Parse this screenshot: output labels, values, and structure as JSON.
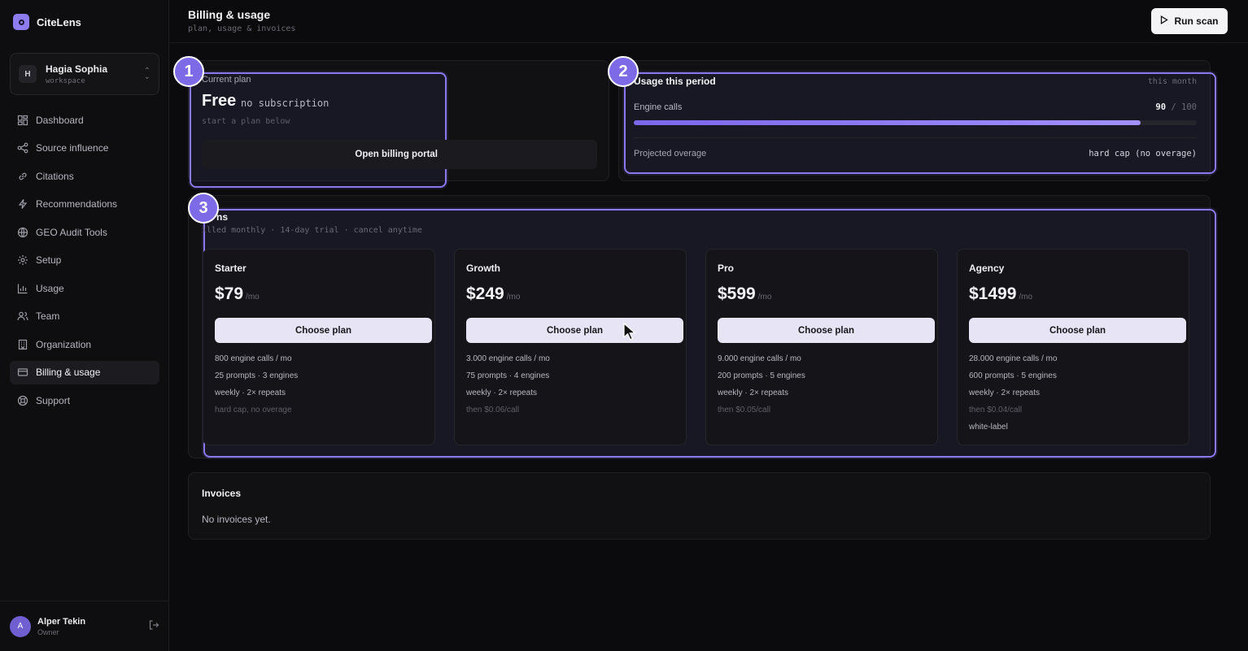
{
  "app": {
    "name": "CiteLens"
  },
  "workspace": {
    "initial": "H",
    "name": "Hagia Sophia",
    "sub": "workspace"
  },
  "nav": [
    {
      "label": "Dashboard",
      "icon": "dashboard-icon"
    },
    {
      "label": "Source influence",
      "icon": "share-icon"
    },
    {
      "label": "Citations",
      "icon": "link-icon"
    },
    {
      "label": "Recommendations",
      "icon": "lightning-icon"
    },
    {
      "label": "GEO Audit Tools",
      "icon": "globe-icon"
    },
    {
      "label": "Setup",
      "icon": "gear-icon"
    },
    {
      "label": "Usage",
      "icon": "bar-chart-icon"
    },
    {
      "label": "Team",
      "icon": "users-icon"
    },
    {
      "label": "Organization",
      "icon": "building-icon"
    },
    {
      "label": "Billing & usage",
      "icon": "credit-card-icon",
      "active": true
    },
    {
      "label": "Support",
      "icon": "lifebuoy-icon"
    }
  ],
  "user": {
    "initial": "A",
    "name": "Alper Tekin",
    "role": "Owner"
  },
  "header": {
    "title": "Billing & usage",
    "subtitle": "plan, usage & invoices",
    "run_label": "Run scan"
  },
  "annotations": [
    "1",
    "2",
    "3"
  ],
  "current_plan": {
    "label": "Current plan",
    "name": "Free",
    "status": "no subscription",
    "hint": "start a plan below",
    "portal_label": "Open billing portal"
  },
  "usage": {
    "title": "Usage this period",
    "period": "this month",
    "engine_label": "Engine calls",
    "used": "90",
    "limit": "/ 100",
    "used_fraction": 0.9,
    "overage_label": "Projected overage",
    "overage_value": "hard cap (no overage)"
  },
  "plans": {
    "title": "ns",
    "subtitle": "illed monthly · 14-day trial · cancel anytime",
    "choose_label": "Choose plan",
    "per": "/mo",
    "tiers": [
      {
        "name": "Starter",
        "price": "$79",
        "features": [
          "800 engine calls / mo",
          "25 prompts · 3 engines",
          "weekly · 2× repeats"
        ],
        "dim": "hard cap, no overage",
        "extra": ""
      },
      {
        "name": "Growth",
        "price": "$249",
        "features": [
          "3.000 engine calls / mo",
          "75 prompts · 4 engines",
          "weekly · 2× repeats"
        ],
        "dim": "then $0.06/call",
        "extra": ""
      },
      {
        "name": "Pro",
        "price": "$599",
        "features": [
          "9.000 engine calls / mo",
          "200 prompts · 5 engines",
          "weekly · 2× repeats"
        ],
        "dim": "then $0.05/call",
        "extra": ""
      },
      {
        "name": "Agency",
        "price": "$1499",
        "features": [
          "28.000 engine calls / mo",
          "600 prompts · 5 engines",
          "weekly · 2× repeats"
        ],
        "dim": "then $0.04/call",
        "extra": "white-label"
      }
    ]
  },
  "invoices": {
    "title": "Invoices",
    "empty": "No invoices yet."
  }
}
